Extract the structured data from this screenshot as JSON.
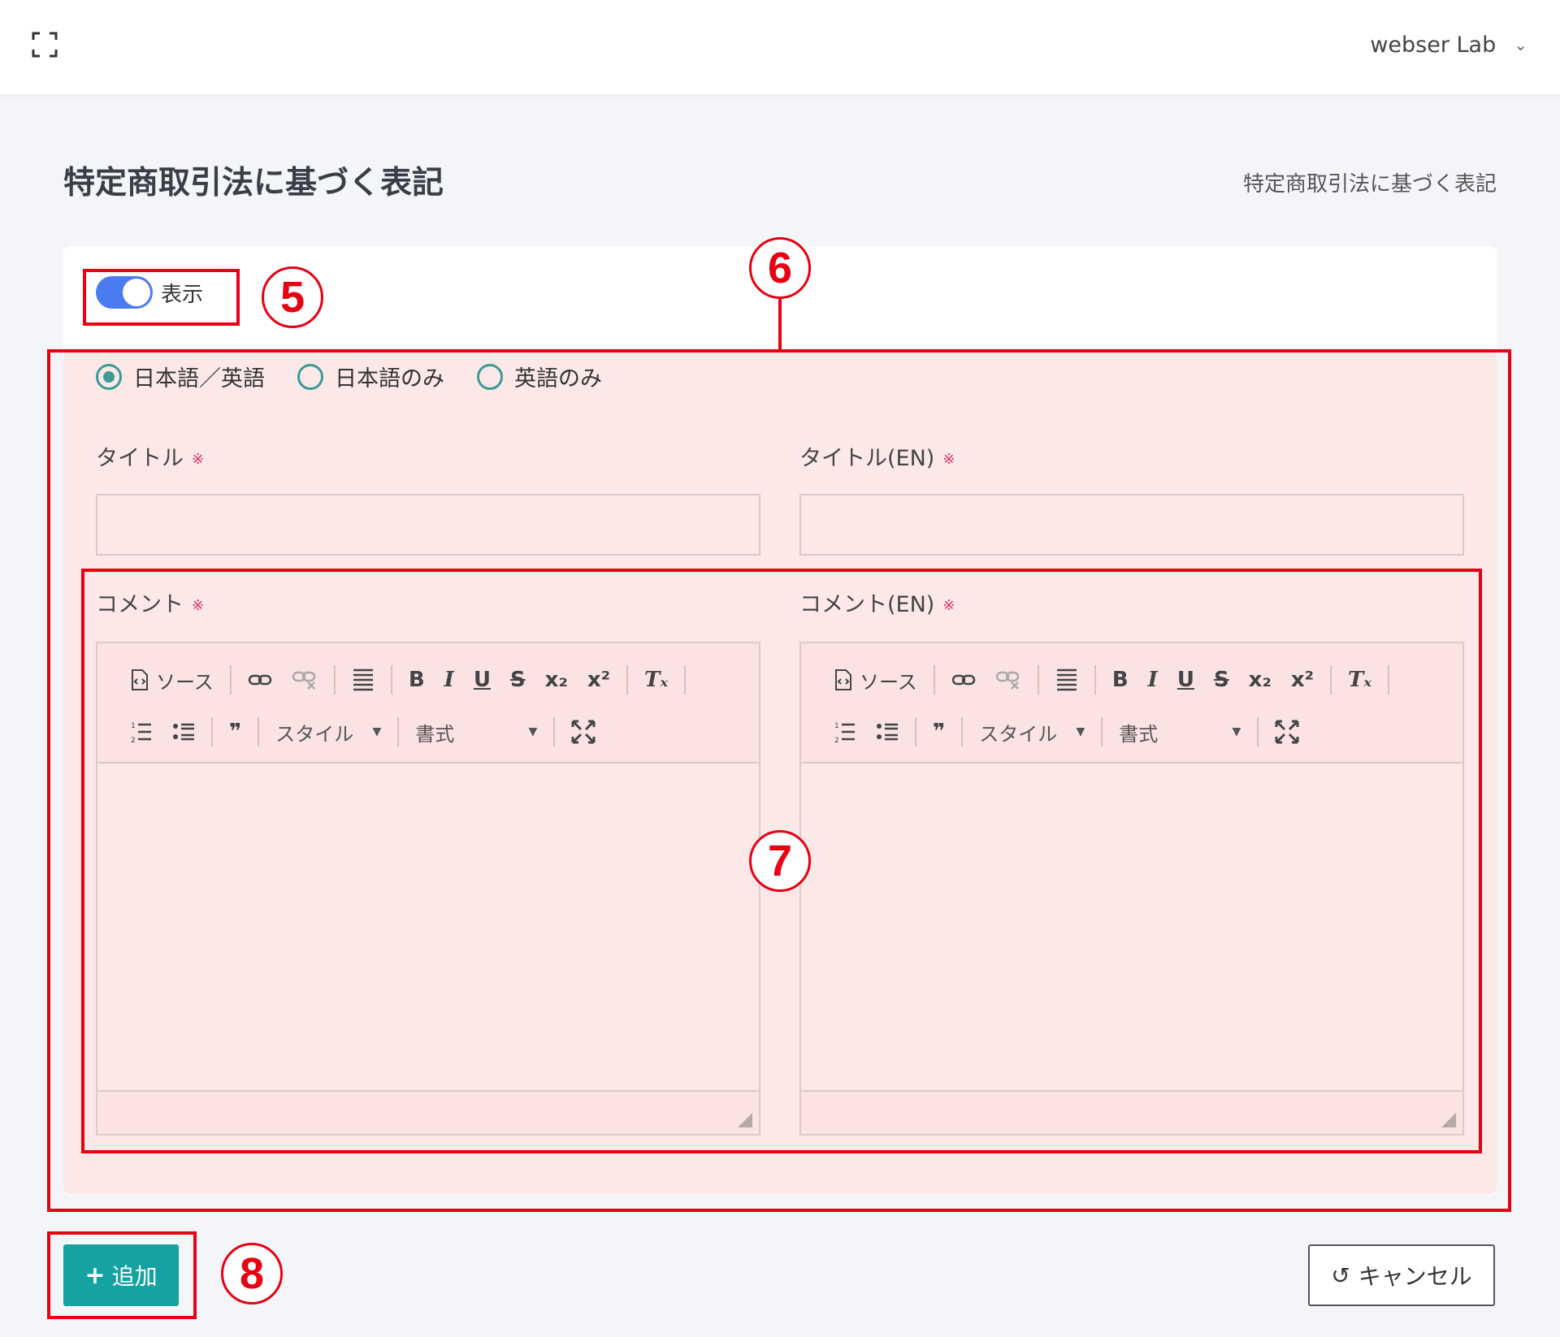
{
  "header": {
    "expand_icon": "fullscreen-icon",
    "user_name": "webser Lab",
    "chevron": "⌄"
  },
  "page": {
    "title": "特定商取引法に基づく表記",
    "breadcrumb": "特定商取引法に基づく表記"
  },
  "form": {
    "display_toggle": {
      "label": "表示",
      "on": true
    },
    "language_options": [
      {
        "label": "日本語／英語",
        "selected": true
      },
      {
        "label": "日本語のみ",
        "selected": false
      },
      {
        "label": "英語のみ",
        "selected": false
      }
    ],
    "required_mark": "※",
    "title_label": "タイトル",
    "title_en_label": "タイトル(EN)",
    "title_value": "",
    "title_en_value": "",
    "comment_label": "コメント",
    "comment_en_label": "コメント(EN)",
    "editor_toolbar": {
      "source": "ソース",
      "bold": "B",
      "italic": "I",
      "underline": "U",
      "strike": "S",
      "subscript": "x₂",
      "superscript": "x²",
      "clear_format": "Tₓ",
      "quote": "❞",
      "style_select": "スタイル",
      "format_select": "書式"
    }
  },
  "annotations": {
    "five": "5",
    "six": "6",
    "seven": "7",
    "eight": "8",
    "color": "#e60012"
  },
  "actions": {
    "add_label": "追加",
    "add_icon": "+",
    "cancel_label": "キャンセル",
    "cancel_icon": "↺"
  },
  "colors": {
    "toggle_on": "#4a7bf0",
    "radio": "#3a9b97",
    "primary_button": "#17a2a2",
    "required": "#d6336c",
    "highlight_bg": "#fde8e8"
  }
}
